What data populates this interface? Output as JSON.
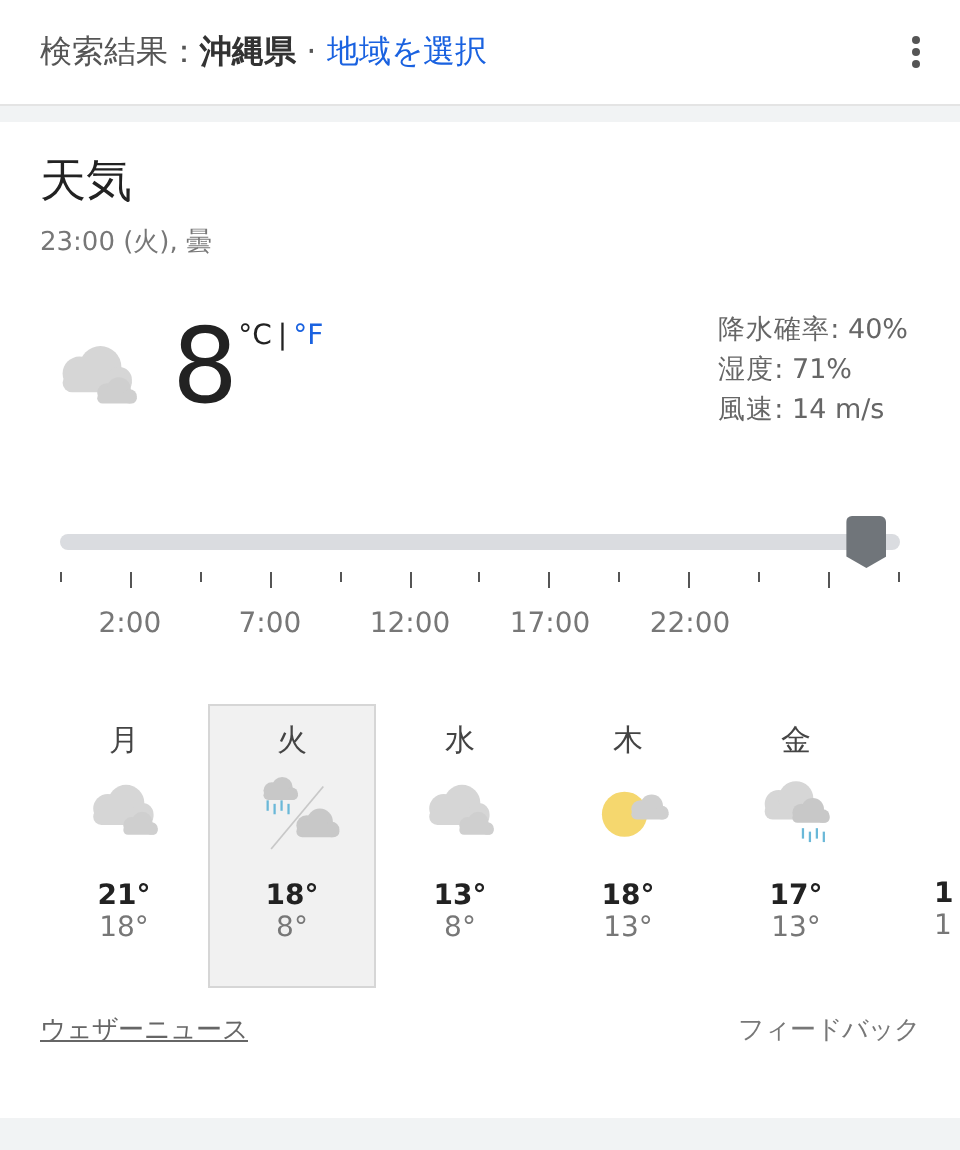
{
  "header": {
    "prefix": "検索結果：",
    "place": "沖縄県",
    "separator": "·",
    "link": "地域を選択"
  },
  "weather": {
    "title": "天気",
    "subtitle": "23:00 (火), 曇",
    "temperature": "8",
    "units": [
      {
        "label": "°C",
        "selected": true
      },
      {
        "label": "°F",
        "selected": false
      }
    ],
    "unit_divider": "|",
    "details": [
      "降水確率: 40%",
      "湿度: 71%",
      "風速: 14 m/s"
    ],
    "timeline": {
      "level": 0.96,
      "labels": [
        "2:00",
        "7:00",
        "12:00",
        "17:00",
        "22:00"
      ]
    },
    "days": [
      {
        "day": "月",
        "kind": "cloudy",
        "high": "21°",
        "low": "18°",
        "selected": false
      },
      {
        "day": "火",
        "kind": "changing",
        "high": "18°",
        "low": "8°",
        "selected": true
      },
      {
        "day": "水",
        "kind": "cloudy",
        "high": "13°",
        "low": "8°",
        "selected": false
      },
      {
        "day": "木",
        "kind": "sunny",
        "high": "18°",
        "low": "13°",
        "selected": false
      },
      {
        "day": "金",
        "kind": "rainy",
        "high": "17°",
        "low": "13°",
        "selected": false
      },
      {
        "kind": "partial",
        "high": "1",
        "low": "1",
        "selected": false
      }
    ],
    "footer": {
      "news_link": "ウェザーニュース",
      "feedback": "フィードバック"
    }
  }
}
